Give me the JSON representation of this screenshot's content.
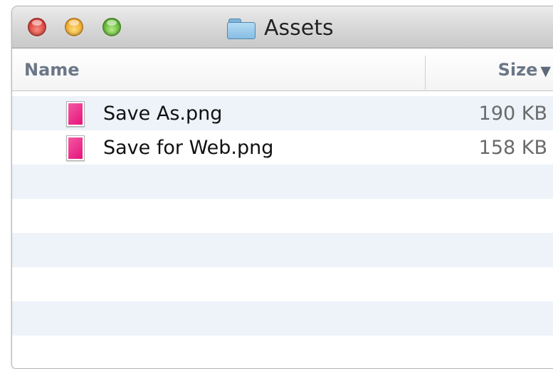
{
  "window": {
    "title": "Assets",
    "title_icon": "folder-icon"
  },
  "columns": {
    "name": "Name",
    "size": "Size",
    "sort_indicator": "▼"
  },
  "files": [
    {
      "name": "Save As.png",
      "size": "190 KB",
      "icon": "png-file-icon"
    },
    {
      "name": "Save for Web.png",
      "size": "158 KB",
      "icon": "png-file-icon"
    }
  ],
  "colors": {
    "close": "#e0443e",
    "minimize": "#f0a72c",
    "zoom": "#5cb32e",
    "row_stripe": "#edf3f9",
    "file_icon": "#e5127a"
  }
}
